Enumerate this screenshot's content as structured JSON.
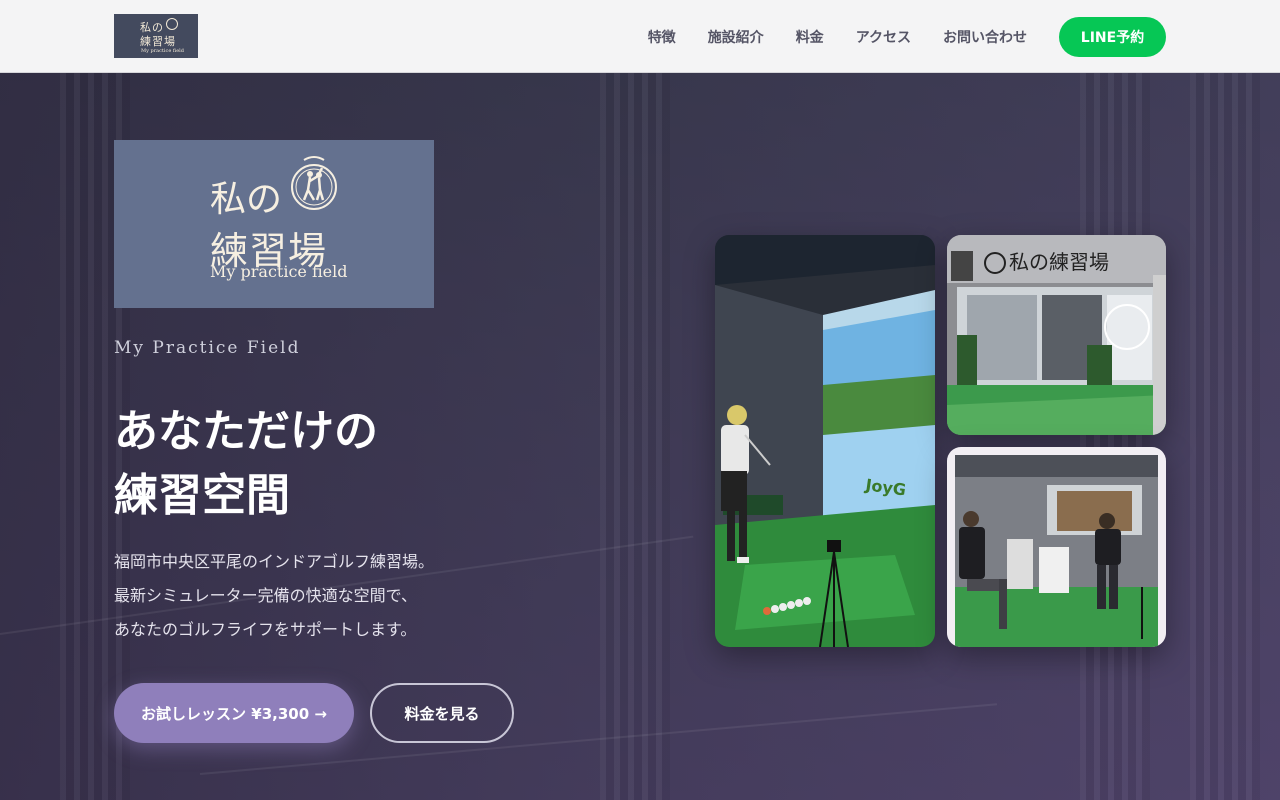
{
  "header": {
    "logo": {
      "line1": "私の",
      "line2": "練習場",
      "line3": "My practice field"
    },
    "nav": [
      "特徴",
      "施設紹介",
      "料金",
      "アクセス",
      "お問い合わせ"
    ],
    "line_button": "LINE予約"
  },
  "hero": {
    "logo": {
      "line1": "私の",
      "line2": "練習場",
      "line3": "My practice field"
    },
    "subtitle": "My Practice Field",
    "headline_line1": "あなただけの",
    "headline_line2": "練習空間",
    "description": [
      "福岡市中央区平尾のインドアゴルフ練習場。",
      "最新シミュレーター完備の快適な空間で、",
      "あなたのゴルフライフをサポートします。"
    ],
    "primary_button": "お試しレッスン ¥3,300 →",
    "secondary_button": "料金を見る"
  },
  "photos": {
    "simulator": {
      "screen_text": "JoyG"
    },
    "storefront": {
      "sign": "私の練習場"
    }
  },
  "colors": {
    "line_green": "#06c755",
    "accent_purple": "#8f7fbb",
    "logo_bg": "#64718f",
    "header_bg": "#f4f4f5"
  }
}
